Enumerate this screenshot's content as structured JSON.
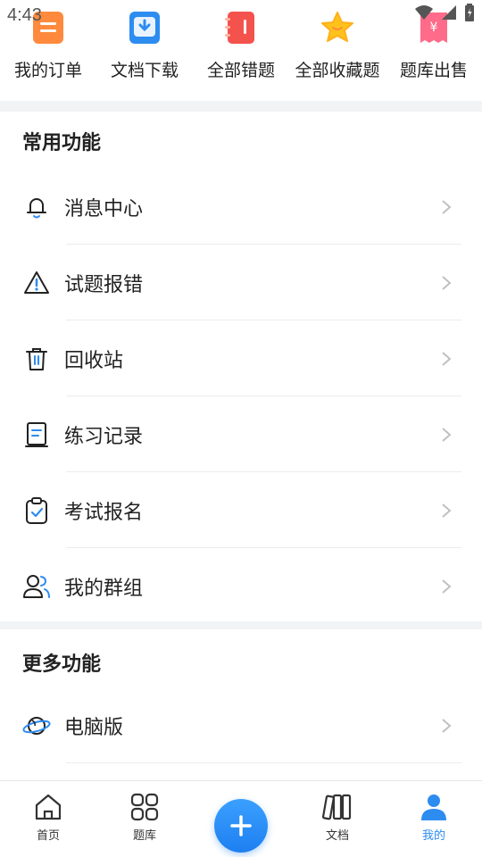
{
  "status_bar": {
    "time": "4:43"
  },
  "quick_access": [
    {
      "label": "我的订单",
      "icon": "order-icon",
      "color": "#ff8a3d"
    },
    {
      "label": "文档下载",
      "icon": "download-icon",
      "color": "#2d8cf0"
    },
    {
      "label": "全部错题",
      "icon": "notebook-icon",
      "color": "#f4524d"
    },
    {
      "label": "全部收藏题",
      "icon": "star-icon",
      "color": "#ffb81c"
    },
    {
      "label": "题库出售",
      "icon": "receipt-yen-icon",
      "color": "#ff6b8a"
    }
  ],
  "common_section": {
    "title": "常用功能",
    "items": [
      {
        "label": "消息中心",
        "icon": "bell-icon"
      },
      {
        "label": "试题报错",
        "icon": "warning-icon"
      },
      {
        "label": "回收站",
        "icon": "trash-icon"
      },
      {
        "label": "练习记录",
        "icon": "record-book-icon"
      },
      {
        "label": "考试报名",
        "icon": "clipboard-check-icon"
      },
      {
        "label": "我的群组",
        "icon": "group-icon"
      }
    ]
  },
  "more_section": {
    "title": "更多功能",
    "items": [
      {
        "label": "电脑版",
        "icon": "planet-icon"
      }
    ]
  },
  "bottom_nav": {
    "items": [
      {
        "label": "首页",
        "icon": "home-icon"
      },
      {
        "label": "题库",
        "icon": "grid-icon"
      },
      {
        "label": "",
        "icon": "plus-icon"
      },
      {
        "label": "文档",
        "icon": "books-icon"
      },
      {
        "label": "我的",
        "icon": "user-icon",
        "active": true
      }
    ]
  },
  "colors": {
    "accent": "#2d8cf0",
    "separator": "#f2f3f5"
  }
}
